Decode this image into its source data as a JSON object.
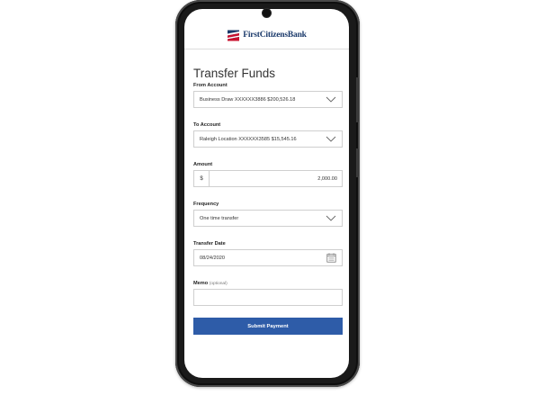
{
  "brand": {
    "name": "FirstCitizensBank"
  },
  "page": {
    "title": "Transfer Funds"
  },
  "form": {
    "from_account": {
      "label": "From Account",
      "value": "Business Draw XXXXXX3886 $200,526.18"
    },
    "to_account": {
      "label": "To Account",
      "value": "Raleigh Location XXXXXX3585 $15,545.16"
    },
    "amount": {
      "label": "Amount",
      "currency": "$",
      "value": "2,000.00"
    },
    "frequency": {
      "label": "Frequency",
      "value": "One time transfer"
    },
    "transfer_date": {
      "label": "Transfer Date",
      "value": "08/24/2020"
    },
    "memo": {
      "label": "Memo",
      "hint": "(optional)",
      "value": ""
    },
    "submit_label": "Submit Payment"
  },
  "colors": {
    "brand_navy": "#1b3a6b",
    "brand_red": "#c8102e",
    "primary_button": "#2e5ca8"
  },
  "icons": [
    "chevron-down-icon",
    "calendar-icon",
    "bank-flag-logo"
  ]
}
